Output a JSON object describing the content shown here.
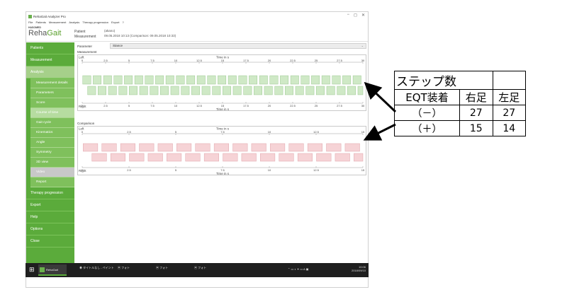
{
  "window": {
    "title": "RehaGait Analyzer Pro",
    "controls": [
      "−",
      "◻",
      "✕"
    ]
  },
  "menu": [
    "File",
    "Patients",
    "Measurement",
    "Analysis",
    "Therapy progression",
    "Export",
    "?"
  ],
  "logo": {
    "small": "HASOMED",
    "reha": "Reha",
    "gait": "Gait"
  },
  "header": {
    "patient_label": "Patient",
    "patient_value": "(akano)",
    "measurement_label": "Measurement",
    "measurement_value": "09.05.2018 10:13 (Comparison: 09.05.2018 10:33)"
  },
  "sidebar": {
    "items_top": [
      "Patients",
      "Measurement",
      "Analysis"
    ],
    "sub_items": [
      {
        "label": "Measurement details",
        "state": "normal"
      },
      {
        "label": "Parameters",
        "state": "normal"
      },
      {
        "label": "Score",
        "state": "normal"
      },
      {
        "label": "Course of time",
        "state": "selected"
      },
      {
        "label": "Gait cycle",
        "state": "normal"
      },
      {
        "label": "Kinematics",
        "state": "normal"
      },
      {
        "label": "Angle",
        "state": "normal"
      },
      {
        "label": "Symmetry",
        "state": "normal"
      },
      {
        "label": "3D view",
        "state": "normal"
      },
      {
        "label": "Video",
        "state": "disabled"
      },
      {
        "label": "Report",
        "state": "normal"
      }
    ],
    "items_bottom": [
      "Therapy progression",
      "Export",
      "Help",
      "Options",
      "Close"
    ]
  },
  "parameter": {
    "label": "Parameter",
    "value": "Stance"
  },
  "measurement_chart": {
    "label": "Measurement",
    "time_label": "Time in s",
    "left_label": "Left",
    "right_label": "Right",
    "ticks": [
      "0",
      "2.5",
      "5",
      "7.5",
      "10",
      "12.5",
      "15",
      "17.5",
      "20",
      "22.5",
      "25",
      "27.5",
      "30"
    ],
    "color": "#cfe9c6",
    "stroke": "#8cbf80",
    "max": 30,
    "count": 27
  },
  "comparison_chart": {
    "label": "Comparison",
    "time_label": "Time in s",
    "left_label": "Left",
    "right_label": "Right",
    "ticks": [
      "0",
      "2.5",
      "5",
      "7.5",
      "10",
      "12.5",
      "15"
    ],
    "color": "#f6d3d6",
    "stroke": "#d9959c",
    "max": 15,
    "count": 15
  },
  "taskbar": {
    "windows_icon": "windows-logo-icon",
    "items": [
      "RehaGait",
      "タイトルなし - ペイント",
      "フォト",
      "フォト",
      "フォト"
    ],
    "tray_time": "10:06",
    "tray_date": "2018/09/10",
    "tray_lang": "A"
  },
  "step_table": {
    "title": "ステップ数",
    "col_header": "EQT装着",
    "right_foot": "右足",
    "left_foot": "左足",
    "rows": [
      {
        "label": "（－）",
        "right": "27",
        "left": "27"
      },
      {
        "label": "（＋）",
        "right": "15",
        "left": "14"
      }
    ]
  }
}
